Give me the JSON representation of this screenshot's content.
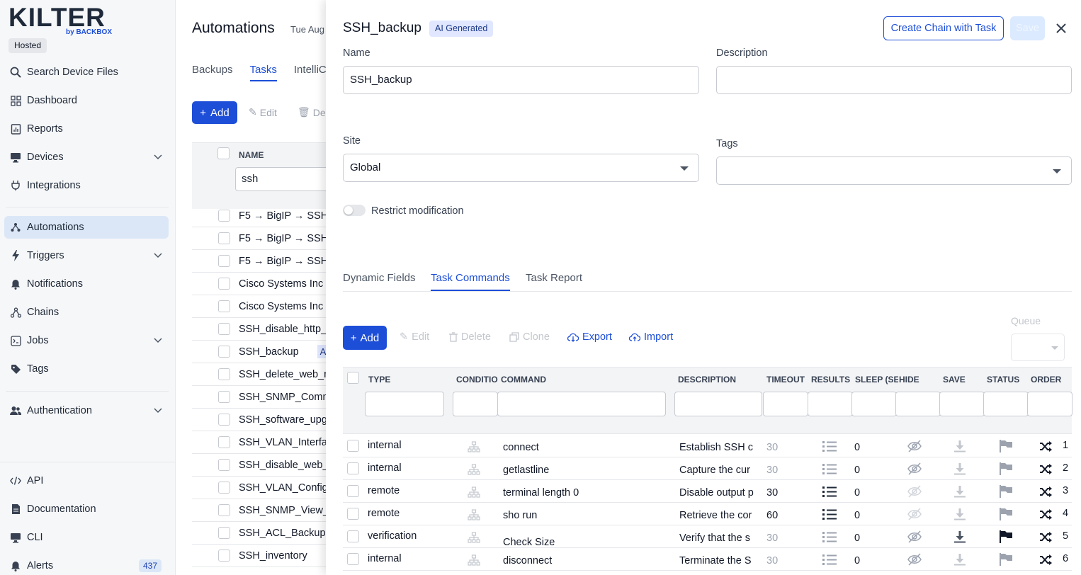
{
  "sidebar": {
    "logo": "KILTER",
    "logo_sub": "by BACKBOX",
    "hosted": "Hosted",
    "items": [
      {
        "label": "Search Device Files",
        "icon": "search-icon"
      },
      {
        "label": "Dashboard",
        "icon": "dashboard-icon"
      },
      {
        "label": "Reports",
        "icon": "reports-icon"
      },
      {
        "label": "Devices",
        "icon": "monitor-icon"
      },
      {
        "label": "Integrations",
        "icon": "plug-icon"
      },
      {
        "label": "Automations",
        "icon": "automation-icon"
      },
      {
        "label": "Triggers",
        "icon": "bolt-icon"
      },
      {
        "label": "Notifications",
        "icon": "bell-icon"
      },
      {
        "label": "Chains",
        "icon": "chain-icon"
      },
      {
        "label": "Jobs",
        "icon": "jobs-icon"
      },
      {
        "label": "Tags",
        "icon": "tag-icon"
      },
      {
        "label": "Authentication",
        "icon": "users-icon"
      }
    ],
    "bottom": [
      {
        "label": "API",
        "icon": "code-icon"
      },
      {
        "label": "Documentation",
        "icon": "document-icon"
      },
      {
        "label": "CLI",
        "icon": "monitor-icon"
      },
      {
        "label": "Alerts",
        "icon": "bell-icon",
        "count": "437"
      }
    ]
  },
  "main": {
    "title": "Automations",
    "date": "Tue Aug",
    "tabs": [
      "Backups",
      "Tasks",
      "IntelliC"
    ],
    "add_label": "Add",
    "edit_label": "Edit",
    "delete_label": "De",
    "column_name": "NAME",
    "filter_value": "ssh",
    "rows": [
      "F5 → BigIP → SSH",
      "F5 → BigIP → SSH",
      "F5 → BigIP → SSH",
      "Cisco Systems Inc",
      "Cisco Systems Inc",
      "SSH_disable_http_s",
      "SSH_backup",
      "SSH_delete_web_m",
      "SSH_SNMP_Comm",
      "SSH_software_upg",
      "SSH_VLAN_Interfa",
      "SSH_disable_web_",
      "SSH_VLAN_Config",
      "SSH_SNMP_View_C",
      "SSH_ACL_Backup",
      "SSH_inventory"
    ],
    "ai_short": "AI"
  },
  "drawer": {
    "title": "SSH_backup",
    "ai_tag": "AI Generated",
    "chain_button": "Create Chain with Task",
    "save_button": "Save",
    "name_label": "Name",
    "name_value": "SSH_backup",
    "description_label": "Description",
    "description_value": "",
    "site_label": "Site",
    "site_value": "Global",
    "tags_label": "Tags",
    "tags_value": "",
    "restrict_label": "Restrict modification",
    "restrict_on": false,
    "tabs": [
      "Dynamic Fields",
      "Task Commands",
      "Task Report"
    ],
    "active_tab": "Task Commands",
    "toolbar": {
      "add": "Add",
      "edit": "Edit",
      "delete": "Delete",
      "clone": "Clone",
      "export": "Export",
      "import": "Import"
    },
    "queue_label": "Queue",
    "columns": [
      "TYPE",
      "CONDITIO",
      "COMMAND",
      "DESCRIPTION",
      "TIMEOUT",
      "RESULTS",
      "SLEEP (SE",
      "HIDE",
      "SAVE",
      "STATUS",
      "ORDER"
    ],
    "commands": [
      {
        "type": "internal",
        "command": "connect",
        "description": "Establish SSH c",
        "timeout": "30",
        "sleep": "0",
        "order": "1"
      },
      {
        "type": "internal",
        "command": "getlastline",
        "description": "Capture the cur",
        "timeout": "30",
        "sleep": "0",
        "order": "2"
      },
      {
        "type": "remote",
        "command": "terminal length 0",
        "description": "Disable output p",
        "timeout": "30",
        "sleep": "0",
        "order": "3"
      },
      {
        "type": "remote",
        "command": "sho run",
        "description": "Retrieve the cor",
        "timeout": "60",
        "sleep": "0",
        "order": "4"
      },
      {
        "type": "verification",
        "command": "Check Size",
        "description": "Verify that the s",
        "timeout": "30",
        "sleep": "0",
        "order": "5"
      },
      {
        "type": "internal",
        "command": "disconnect",
        "description": "Terminate the S",
        "timeout": "30",
        "sleep": "0",
        "order": "6"
      }
    ]
  }
}
